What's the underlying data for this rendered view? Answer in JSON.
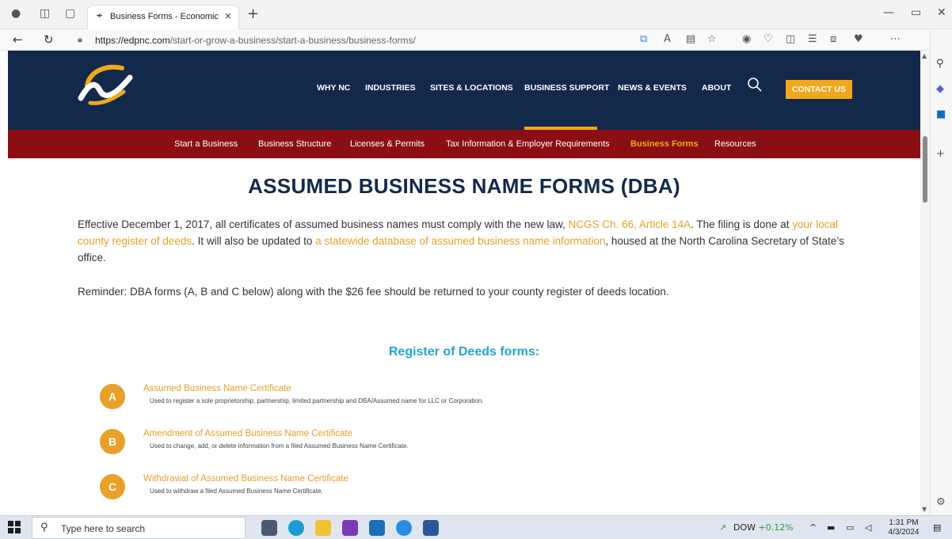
{
  "browser": {
    "tab_title": "Business Forms - Economic Deve",
    "tab_close": "×",
    "new_tab": "+",
    "url_host": "https://edpnc.com",
    "url_path": "/start-or-grow-a-business/start-a-business/business-forms/"
  },
  "header": {
    "nav": [
      "WHY NC",
      "INDUSTRIES",
      "SITES & LOCATIONS",
      "BUSINESS SUPPORT",
      "NEWS & EVENTS",
      "ABOUT"
    ],
    "active_nav": "BUSINESS SUPPORT",
    "contact": "CONTACT US"
  },
  "subnav": {
    "items": [
      "Start a Business",
      "Business Structure",
      "Licenses & Permits",
      "Tax Information & Employer Requirements",
      "Business Forms",
      "Resources"
    ],
    "active": "Business Forms"
  },
  "main": {
    "heading": "ASSUMED BUSINESS NAME FORMS (DBA)",
    "para_1": "Effective December 1, 2017, all certificates of assumed business names must comply with the new law, ",
    "link_1": "NCGS Ch. 66, Article 14A",
    "para_2": ". The filing is done at ",
    "link_2": "your local county register of deeds",
    "para_3": ". It will also be updated to ",
    "link_3": "a statewide database of assumed business name information",
    "para_4": ", housed at the North Carolina Secretary of State’s office.",
    "reminder": "Reminder: DBA forms (A, B and C below) along with the $26 fee should be returned to your county register of deeds location.",
    "forms_heading": "Register of Deeds forms:",
    "forms": [
      {
        "letter": "A",
        "title": "Assumed Business Name Certificate",
        "desc": "Used to register a sole proprietorship, partnership, limited partnership and DBA/Assumed name for LLC or Corporation."
      },
      {
        "letter": "B",
        "title": "Amendment of Assumed Business Name Certificate",
        "desc": "Used to change, add, or delete information from a filed Assumed Business Name Certificate."
      },
      {
        "letter": "C",
        "title": "Withdrawal of Assumed Business Name Certificate",
        "desc": "Used to withdraw a filed Assumed Business Name Certificate."
      }
    ]
  },
  "taskbar": {
    "search_placeholder": "Type here to search",
    "dow_label": "DOW",
    "dow_change": "+0.12%",
    "time": "1:31 PM",
    "date": "4/3/2024"
  },
  "colors": {
    "navy": "#13294b",
    "maroon": "#8b0f12",
    "gold": "#f0a81c",
    "link": "#e8a02a",
    "teal": "#1ea8d6"
  }
}
